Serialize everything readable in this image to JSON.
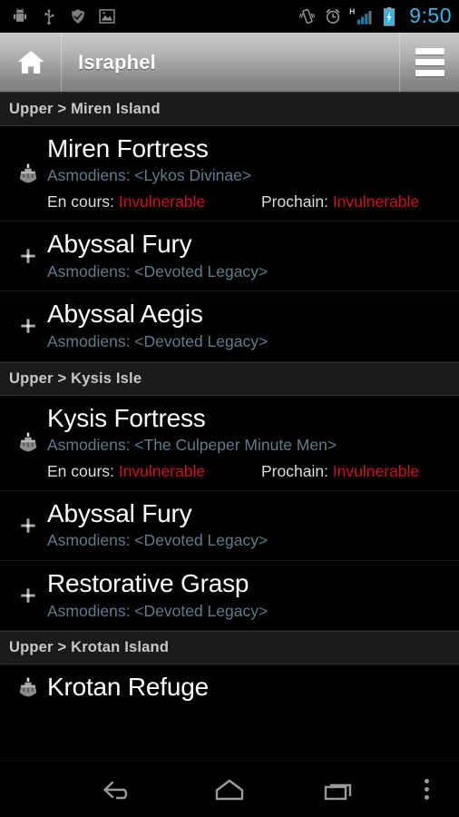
{
  "status_bar": {
    "time": "9:50",
    "left_icons": [
      "android-debug-icon",
      "usb-icon",
      "shield-check-icon",
      "gallery-icon"
    ],
    "right_icons": [
      "vibrate-icon",
      "alarm-clock-icon",
      "hspa-signal-icon",
      "battery-charging-icon"
    ],
    "accent_color": "#33b5e5"
  },
  "action_bar": {
    "home_icon": "home-icon",
    "title": "Israphel",
    "menu_icon": "hamburger-menu-icon"
  },
  "list": {
    "sections": [
      {
        "header": "Upper > Miren Island",
        "rows": [
          {
            "icon": "fortress-icon",
            "title": "Miren Fortress",
            "subtitle": "Asmodiens: <Lykos Divinae>",
            "status": {
              "current_label": "En cours:",
              "current_value": "Invulnerable",
              "next_label": "Prochain:",
              "next_value": "Invulnerable"
            }
          },
          {
            "icon": "artifact-icon",
            "title": "Abyssal Fury",
            "subtitle": "Asmodiens: <Devoted Legacy>",
            "status": null
          },
          {
            "icon": "artifact-icon",
            "title": "Abyssal Aegis",
            "subtitle": "Asmodiens: <Devoted Legacy>",
            "status": null
          }
        ]
      },
      {
        "header": "Upper > Kysis Isle",
        "rows": [
          {
            "icon": "fortress-icon",
            "title": "Kysis Fortress",
            "subtitle": "Asmodiens: <The Culpeper Minute Men>",
            "status": {
              "current_label": "En cours:",
              "current_value": "Invulnerable",
              "next_label": "Prochain:",
              "next_value": "Invulnerable"
            }
          },
          {
            "icon": "artifact-icon",
            "title": "Abyssal Fury",
            "subtitle": "Asmodiens: <Devoted Legacy>",
            "status": null
          },
          {
            "icon": "artifact-icon",
            "title": "Restorative Grasp",
            "subtitle": "Asmodiens: <Devoted Legacy>",
            "status": null
          }
        ]
      },
      {
        "header": "Upper > Krotan Island",
        "rows": [
          {
            "icon": "fortress-icon",
            "title": "Krotan Refuge",
            "subtitle": "",
            "status": null,
            "clipped": true
          }
        ]
      }
    ]
  },
  "nav_bar": {
    "back": "back-icon",
    "home": "home-icon",
    "recents": "recents-icon",
    "overflow": "overflow-menu-icon"
  },
  "colors": {
    "status_value": "#cc1020",
    "subtitle": "#5e7d8b",
    "section_header_text": "#c9c9c9"
  }
}
